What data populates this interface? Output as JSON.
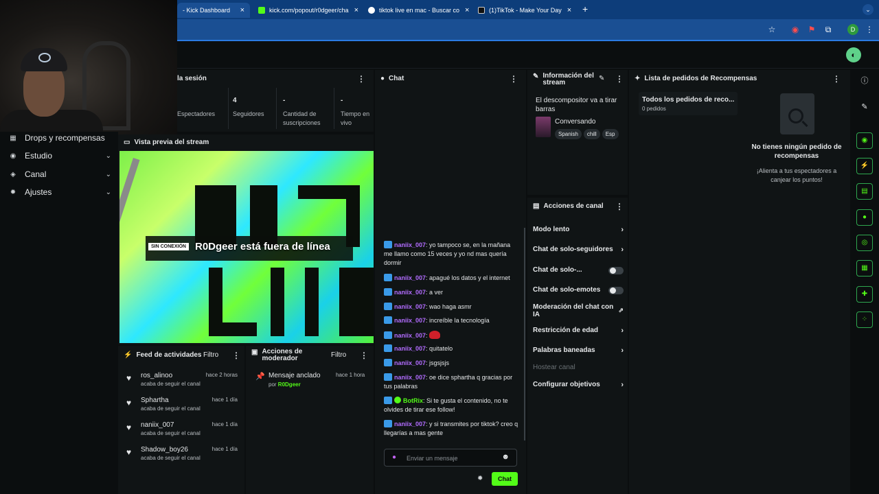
{
  "browser": {
    "tabs": [
      {
        "label": "- Kick Dashboard",
        "fav_color": "#53fc18"
      },
      {
        "label": "kick.com/popout/r0dgeer/cha",
        "fav_color": "#53fc18"
      },
      {
        "label": "tiktok live en mac - Buscar co",
        "fav_color": "#ffffff"
      },
      {
        "label": "(1)TikTok - Make Your Day",
        "fav_color": "#111111"
      }
    ],
    "close_glyph": "×",
    "new_tab": "+",
    "window_menu": "⌄",
    "profile_initial": "D"
  },
  "icons": {
    "star": "star-icon",
    "record": "record-icon",
    "extensions": "puzzle-icon",
    "menu": "kebab-menu-icon"
  },
  "left_nav": [
    {
      "label": "Drops y recompensas",
      "icon": "gift-icon",
      "glyph": "▦",
      "chevron": ""
    },
    {
      "label": "Estudio",
      "icon": "studio-icon",
      "glyph": "◉",
      "chevron": "⌄"
    },
    {
      "label": "Canal",
      "icon": "channel-icon",
      "glyph": "◈",
      "chevron": "⌄"
    },
    {
      "label": "Ajustes",
      "icon": "gear-icon",
      "glyph": "✹",
      "chevron": "⌄"
    }
  ],
  "session": {
    "title": "la sesión",
    "stats": [
      {
        "value": "",
        "label": "Espectadores"
      },
      {
        "value": "4",
        "label": "Seguidores"
      },
      {
        "value": "-",
        "label": "Cantidad de suscripciones"
      },
      {
        "value": "-",
        "label": "Tiempo en vivo"
      }
    ]
  },
  "preview": {
    "title": "Vista previa del stream",
    "badge": "SIN CONEXIÓN",
    "status": "R0Dgeer está fuera de línea"
  },
  "activity_feed": {
    "title": "Feed de actividades",
    "filter": "Filtro",
    "items": [
      {
        "user": "ros_alinoo",
        "time": "hace 2 horas",
        "desc": "acaba de seguir el canal"
      },
      {
        "user": "Sphartha",
        "time": "hace 1 día",
        "desc": "acaba de seguir el canal"
      },
      {
        "user": "naniix_007",
        "time": "hace 1 día",
        "desc": "acaba de seguir el canal"
      },
      {
        "user": "Shadow_boy26",
        "time": "hace 1 día",
        "desc": "acaba de seguir el canal"
      }
    ]
  },
  "mod_actions": {
    "title": "Acciones de moderador",
    "filter": "Filtro",
    "item": {
      "title": "Mensaje anclado",
      "time": "hace 1 hora",
      "by_prefix": "por",
      "by_user": "R0Dgeer"
    }
  },
  "chat": {
    "title": "Chat",
    "messages": [
      {
        "user": "naniix_007",
        "text": "yo tampoco se, en la mañana me llamo como 15 veces y yo nd mas quería dormir",
        "bot": false
      },
      {
        "user": "naniix_007",
        "text": "apagué los datos y el internet",
        "bot": false
      },
      {
        "user": "naniix_007",
        "text": "a ver",
        "bot": false
      },
      {
        "user": "naniix_007",
        "text": "wao haga asmr",
        "bot": false
      },
      {
        "user": "naniix_007",
        "text": "increíble la tecnología",
        "bot": false
      },
      {
        "user": "naniix_007",
        "text": "",
        "bot": false,
        "emote": true
      },
      {
        "user": "naniix_007",
        "text": "quitatelo",
        "bot": false
      },
      {
        "user": "naniix_007",
        "text": "jsgsjsjs",
        "bot": false
      },
      {
        "user": "naniix_007",
        "text": "oe dice sphartha q gracias por tus palabras",
        "bot": false
      },
      {
        "user": "BotRix",
        "text": "Si te gusta el contenido, no te olvides de tirar ese follow!",
        "bot": true
      },
      {
        "user": "naniix_007",
        "text": "y si transmites por tiktok? creo q llegarías a mas gente",
        "bot": false
      }
    ],
    "placeholder": "Enviar un mensaje",
    "send_label": "Chat"
  },
  "stream_info": {
    "title": "Información del stream",
    "stream_title": "El descompositor va a tirar barras",
    "category": "Conversando",
    "tags": [
      "Spanish",
      "chill",
      "Esp"
    ]
  },
  "channel_actions": {
    "title": "Acciones de canal",
    "items": [
      {
        "label": "Modo lento",
        "control": "arrow"
      },
      {
        "label": "Chat de solo-seguidores",
        "control": "arrow"
      },
      {
        "label": "Chat de solo-...",
        "control": "toggle"
      },
      {
        "label": "Chat de solo-emotes",
        "control": "toggle"
      },
      {
        "label": "Moderación del chat con IA",
        "control": "external"
      },
      {
        "label": "Restricción de edad",
        "control": "arrow"
      },
      {
        "label": "Palabras baneadas",
        "control": "arrow"
      },
      {
        "label": "Hostear canal",
        "control": "none"
      },
      {
        "label": "Configurar objetivos",
        "control": "arrow"
      }
    ]
  },
  "rewards": {
    "title": "Lista de pedidos de Recompensas",
    "card_title": "Todos los pedidos de reco...",
    "card_sub": "0 pedidos",
    "empty_title": "No tienes ningún pedido de recompensas",
    "empty_sub": "¡Alienta a tus espectadores a canjear los puntos!"
  },
  "colors": {
    "kick_green": "#53fc18",
    "chat_user": "#b26cff",
    "panel_bg": "#101415",
    "browser_blue": "#1a4f93"
  }
}
